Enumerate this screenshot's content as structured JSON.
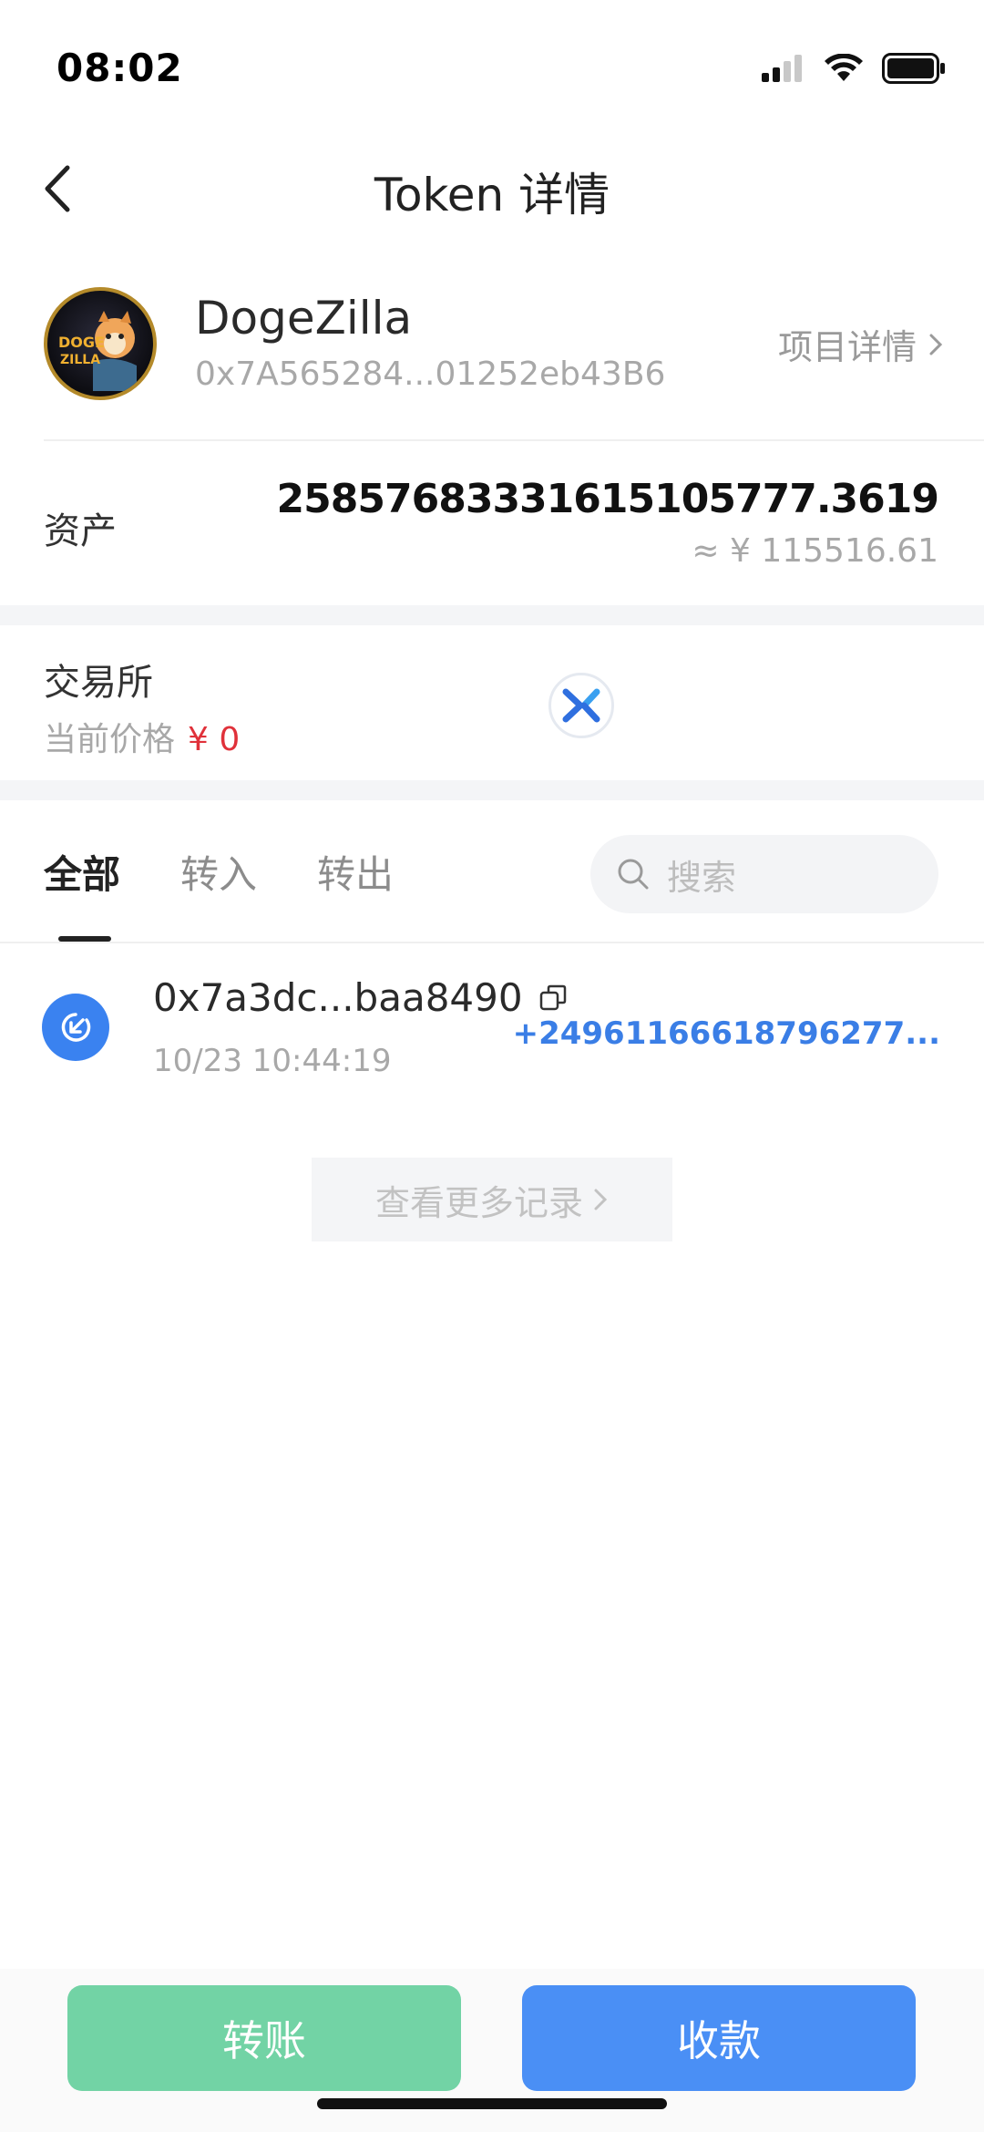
{
  "status_bar": {
    "time": "08:02"
  },
  "header": {
    "title": "Token 详情"
  },
  "token": {
    "name": "DogeZilla",
    "address": "0x7A565284...01252eb43B6",
    "project_link": "项目详情",
    "avatar_text": "DOGE ZILLA"
  },
  "assets": {
    "label": "资产",
    "amount": "25857683331615105777.3619",
    "cny_value": "≈ ¥ 115516.61"
  },
  "exchange": {
    "label": "交易所",
    "price_label": "当前价格",
    "price_value": "¥ 0"
  },
  "tabs": [
    {
      "label": "全部",
      "active": true
    },
    {
      "label": "转入",
      "active": false
    },
    {
      "label": "转出",
      "active": false
    }
  ],
  "search": {
    "placeholder": "搜索"
  },
  "transactions": [
    {
      "hash": "0x7a3dc...baa8490",
      "time": "10/23 10:44:19",
      "amount": "+24961166618796277...",
      "direction": "in"
    }
  ],
  "more_records": "查看更多记录",
  "actions": {
    "transfer": "转账",
    "receive": "收款"
  },
  "colors": {
    "accent_blue": "#4a8ff5",
    "accent_green": "#72d3a5",
    "price_red": "#e0313a"
  }
}
